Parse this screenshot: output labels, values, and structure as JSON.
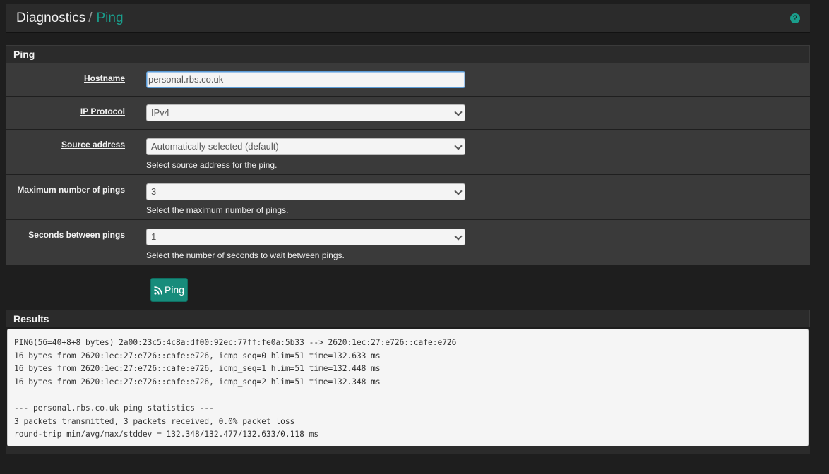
{
  "breadcrumb": {
    "root": "Diagnostics",
    "separator": "/",
    "current": "Ping"
  },
  "help_icon": "?",
  "form": {
    "section_title": "Ping",
    "hostname": {
      "label": "Hostname",
      "value": "personal.rbs.co.uk"
    },
    "ip_protocol": {
      "label": "IP Protocol",
      "value": "IPv4"
    },
    "source_address": {
      "label": "Source address",
      "value": "Automatically selected (default)",
      "help": "Select source address for the ping."
    },
    "max_pings": {
      "label": "Maximum number of pings",
      "value": "3",
      "help": "Select the maximum number of pings."
    },
    "seconds_between": {
      "label": "Seconds between pings",
      "value": "1",
      "help": "Select the number of seconds to wait between pings."
    }
  },
  "ping_button": {
    "label": "Ping",
    "icon": "rss-icon"
  },
  "results": {
    "title": "Results",
    "lines": [
      "PING(56=40+8+8 bytes) 2a00:23c5:4c8a:df00:92ec:77ff:fe0a:5b33 --> 2620:1ec:27:e726::cafe:e726",
      "16 bytes from 2620:1ec:27:e726::cafe:e726, icmp_seq=0 hlim=51 time=132.633 ms",
      "16 bytes from 2620:1ec:27:e726::cafe:e726, icmp_seq=1 hlim=51 time=132.448 ms",
      "16 bytes from 2620:1ec:27:e726::cafe:e726, icmp_seq=2 hlim=51 time=132.348 ms",
      "",
      "--- personal.rbs.co.uk ping statistics ---",
      "3 packets transmitted, 3 packets received, 0.0% packet loss",
      "round-trip min/avg/max/stddev = 132.348/132.477/132.633/0.118 ms"
    ]
  }
}
